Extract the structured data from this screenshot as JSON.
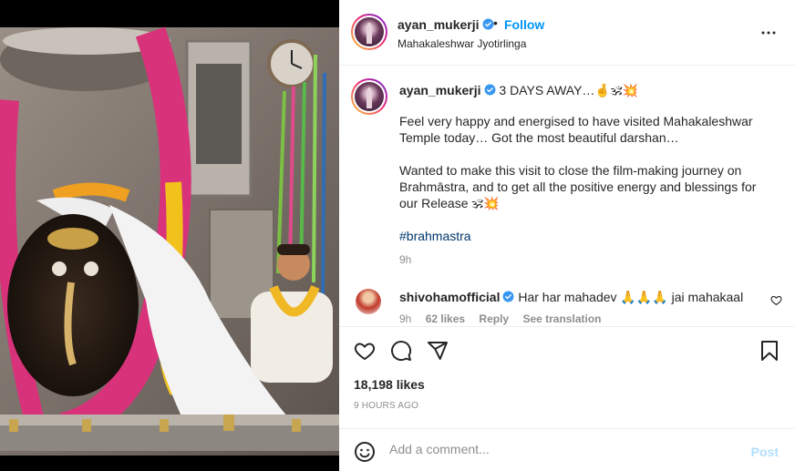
{
  "post": {
    "image_alt": "",
    "header": {
      "username": "ayan_mukerji",
      "separator": "•",
      "follow_label": "Follow",
      "location": "Mahakaleshwar Jyotirlinga"
    },
    "caption": {
      "username": "ayan_mukerji",
      "headline": "3 DAYS AWAY…🤞🕉💥",
      "paragraph1": "Feel very happy and energised to have visited Mahakaleshwar Temple today… Got the most beautiful darshan…",
      "paragraph2": "Wanted to make this visit to close the film-making journey on Brahmāstra, and to get all the positive energy and blessings for our Release 🕉💥",
      "hashtag": "#brahmastra",
      "time": "9h"
    },
    "comment": {
      "username": "shivohamofficial",
      "text": "Har har mahadev 🙏🙏🙏 jai mahakaal",
      "time": "9h",
      "likes": "62 likes",
      "reply": "Reply",
      "see_translation": "See translation"
    },
    "likes": "18,198 likes",
    "posted_ago": "9 HOURS AGO",
    "add_comment_placeholder": "Add a comment...",
    "post_label": "Post"
  },
  "icons": {
    "more": "more-options-icon",
    "verified": "verified-badge-icon",
    "like": "heart-icon",
    "comment": "comment-icon",
    "share": "paper-plane-icon",
    "save": "bookmark-icon",
    "emoji": "smiley-icon"
  },
  "colors": {
    "link": "#0095f6",
    "hashtag": "#00376b",
    "muted": "#8e8e8e",
    "post_disabled": "#b2dffc",
    "verified": "#3897f0"
  }
}
